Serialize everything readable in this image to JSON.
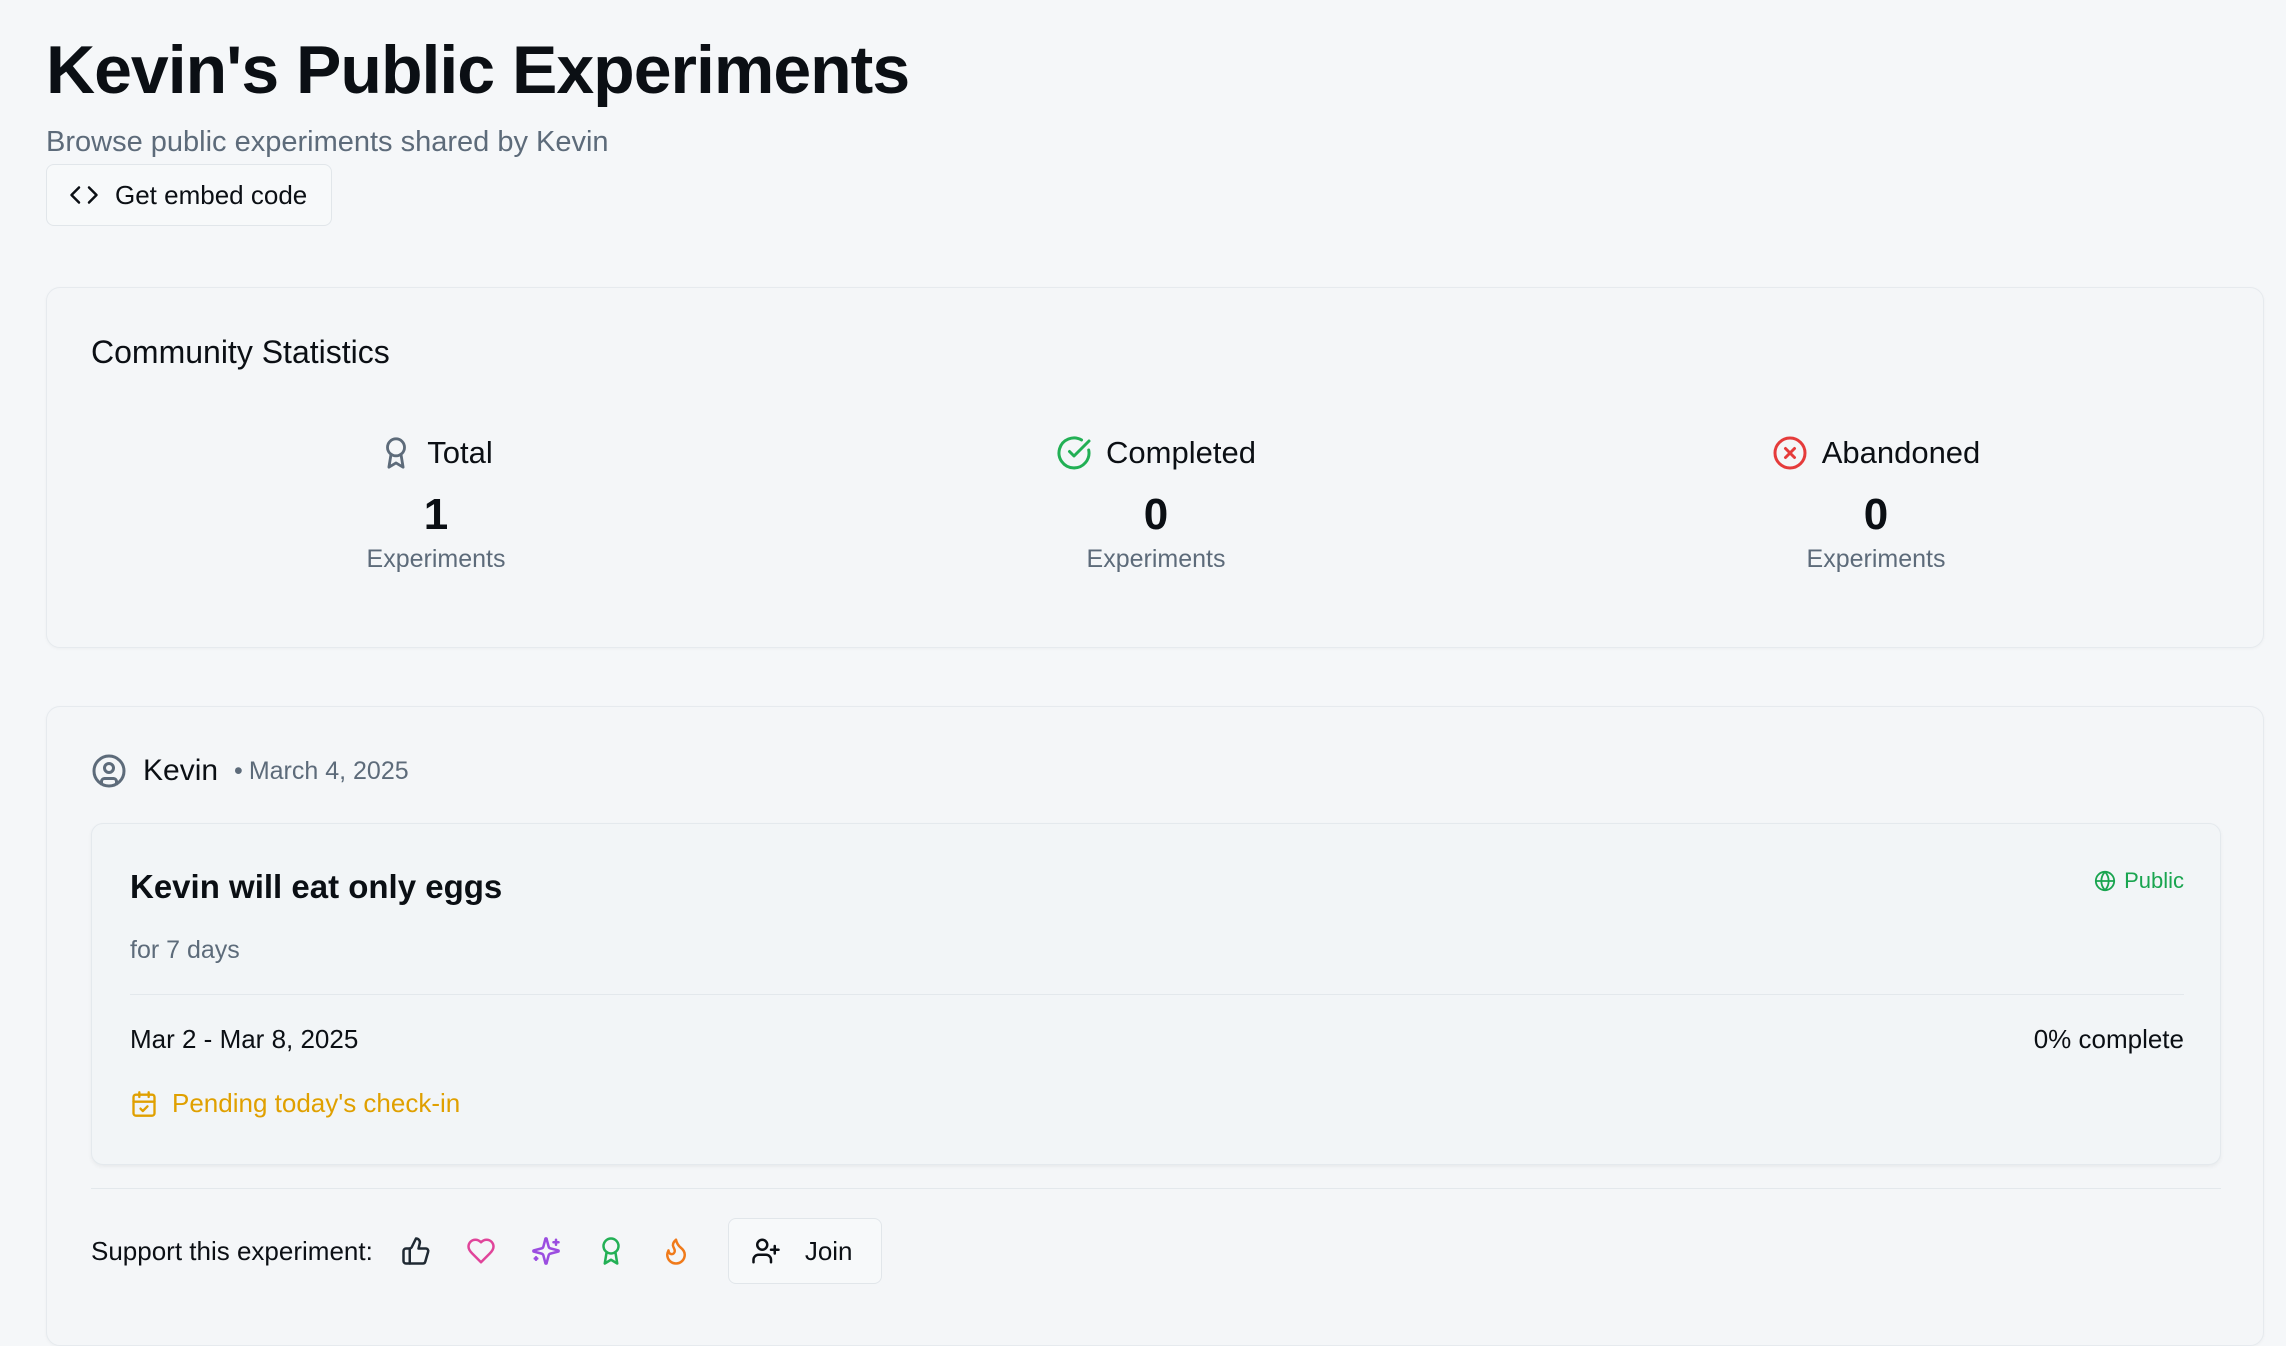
{
  "header": {
    "title": "Kevin's Public Experiments",
    "subtitle": "Browse public experiments shared by Kevin",
    "embed_button": "Get embed code"
  },
  "stats": {
    "title": "Community Statistics",
    "items": [
      {
        "label": "Total",
        "value": "1",
        "unit": "Experiments",
        "icon": "award-icon",
        "color": "#5d6b7a"
      },
      {
        "label": "Completed",
        "value": "0",
        "unit": "Experiments",
        "icon": "check-circle-icon",
        "color": "#22b055"
      },
      {
        "label": "Abandoned",
        "value": "0",
        "unit": "Experiments",
        "icon": "x-circle-icon",
        "color": "#e53b3b"
      }
    ]
  },
  "experiment": {
    "author": "Kevin",
    "separator": "•",
    "date": "March 4, 2025",
    "title": "Kevin will eat only eggs",
    "duration": "for 7 days",
    "visibility": "Public",
    "date_range": "Mar 2 - Mar 8, 2025",
    "progress": "0% complete",
    "checkin_status": "Pending today's check-in"
  },
  "support": {
    "label": "Support this experiment:",
    "reactions": [
      {
        "icon": "thumbs-up-icon",
        "color": "#1f2933"
      },
      {
        "icon": "heart-icon",
        "color": "#e0449a"
      },
      {
        "icon": "sparkles-icon",
        "color": "#9b4de0"
      },
      {
        "icon": "award-icon",
        "color": "#22b055"
      },
      {
        "icon": "flame-icon",
        "color": "#f07a1a"
      }
    ],
    "join_label": "Join"
  },
  "colors": {
    "accent_green": "#1aa550",
    "warning_yellow": "#e0a000",
    "muted_text": "#5d6b7a"
  }
}
